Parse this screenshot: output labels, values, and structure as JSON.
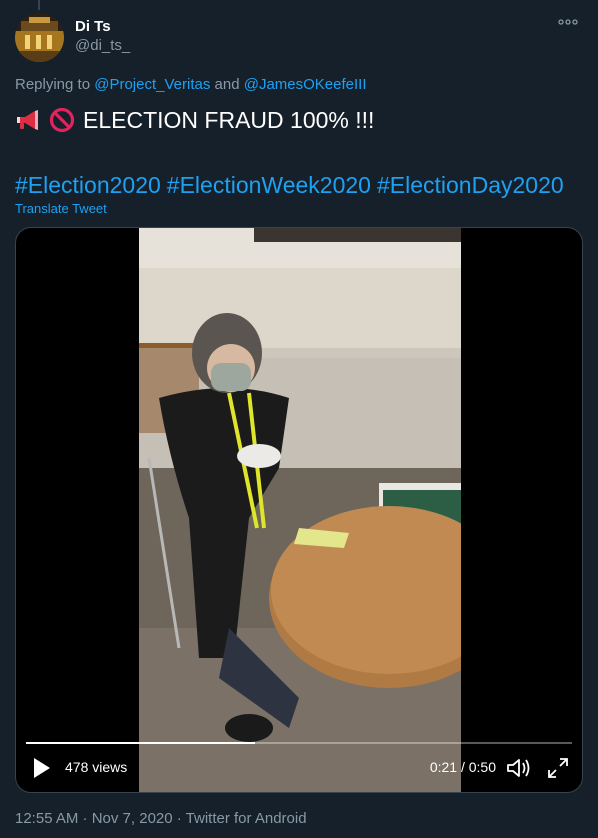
{
  "author": {
    "display_name": "Di Ts",
    "handle": "@di_ts_"
  },
  "reply": {
    "prefix": "Replying to",
    "user1": "@Project_Veritas",
    "conjunction": "and",
    "user2": "@JamesOKeefeIII"
  },
  "tweet": {
    "emoji1": "megaphone-emoji",
    "emoji2": "prohibited-emoji",
    "text": "ELECTION FRAUD 100% !!!",
    "hashtags": [
      "#Election2020",
      "#ElectionWeek2020",
      "#ElectionDay2020"
    ],
    "translate_label": "Translate Tweet"
  },
  "video": {
    "views": "478 views",
    "time": "0:21 / 0:50",
    "progress": 0.42
  },
  "meta": {
    "timestamp": "12:55 AM · Nov 7, 2020",
    "separator": " · ",
    "source": "Twitter for Android"
  },
  "colors": {
    "background": "#15202b",
    "accent": "#1da1f2",
    "secondary_text": "#8899a6",
    "border": "#38444d"
  }
}
